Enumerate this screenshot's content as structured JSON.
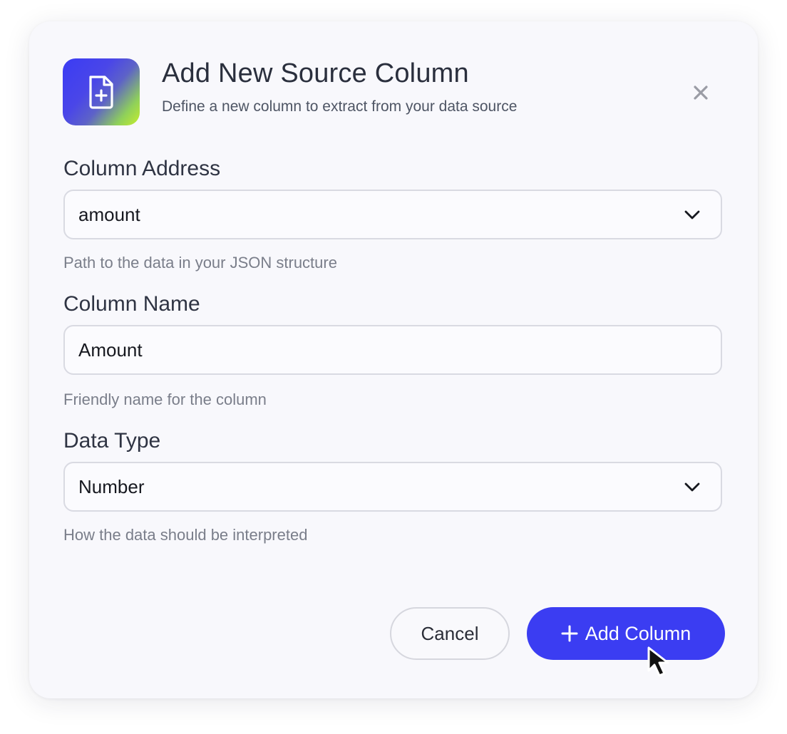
{
  "dialog": {
    "title": "Add New Source Column",
    "subtitle": "Define a new column to extract from your data source",
    "header_icon": "file-plus-icon",
    "close_icon": "close-icon"
  },
  "fields": {
    "column_address": {
      "label": "Column Address",
      "value": "amount",
      "help": "Path to the data in your JSON structure"
    },
    "column_name": {
      "label": "Column Name",
      "value": "Amount",
      "help": "Friendly name for the column"
    },
    "data_type": {
      "label": "Data Type",
      "value": "Number",
      "help": "How the data should be interpreted"
    }
  },
  "actions": {
    "cancel_label": "Cancel",
    "add_label": "Add Column"
  },
  "colors": {
    "accent": "#3b3df2",
    "background": "#f8f8fc",
    "text_primary": "#2a2f3d",
    "text_muted": "#7a7e8a",
    "border": "#d9dae2",
    "close_icon": "#9a9ca5"
  }
}
